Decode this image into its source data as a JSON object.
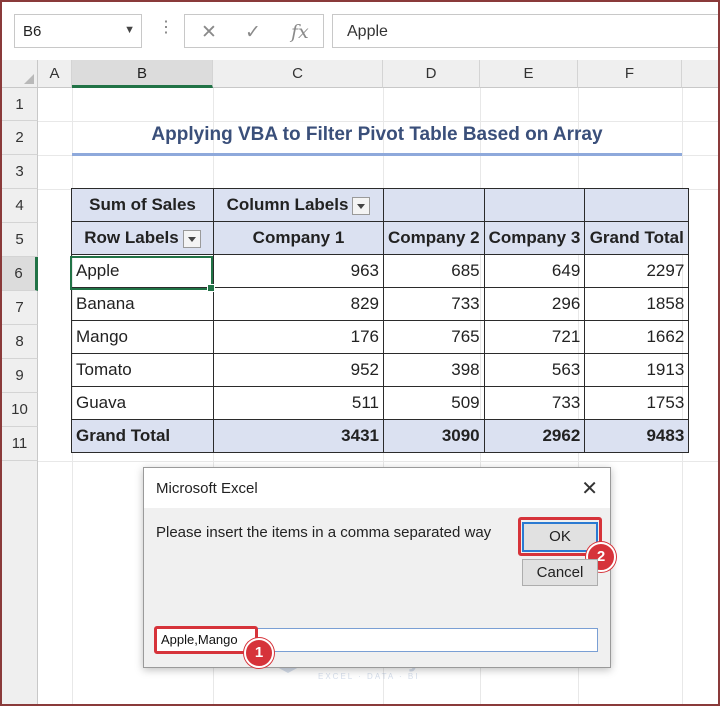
{
  "formula_bar": {
    "name_box": "B6",
    "cancel_icon": "✕",
    "enter_icon": "✓",
    "fx_icon": "fx",
    "value": "Apple"
  },
  "columns": [
    "A",
    "B",
    "C",
    "D",
    "E",
    "F"
  ],
  "rows": [
    "1",
    "2",
    "3",
    "4",
    "5",
    "6",
    "7",
    "8",
    "9",
    "10",
    "11"
  ],
  "selected_cell": "B6",
  "sheet_title": "Applying VBA to Filter Pivot Table Based on Array",
  "pivot": {
    "sum_label": "Sum of Sales",
    "column_labels": "Column Labels",
    "row_labels": "Row Labels",
    "companies": [
      "Company 1",
      "Company 2",
      "Company 3"
    ],
    "grand_total_header": "Grand Total",
    "rows": [
      {
        "label": "Apple",
        "c1": "963",
        "c2": "685",
        "c3": "649",
        "total": "2297"
      },
      {
        "label": "Banana",
        "c1": "829",
        "c2": "733",
        "c3": "296",
        "total": "1858"
      },
      {
        "label": "Mango",
        "c1": "176",
        "c2": "765",
        "c3": "721",
        "total": "1662"
      },
      {
        "label": "Tomato",
        "c1": "952",
        "c2": "398",
        "c3": "563",
        "total": "1913"
      },
      {
        "label": "Guava",
        "c1": "511",
        "c2": "509",
        "c3": "733",
        "total": "1753"
      }
    ],
    "grand_total": {
      "label": "Grand Total",
      "c1": "3431",
      "c2": "3090",
      "c3": "2962",
      "total": "9483"
    }
  },
  "dialog": {
    "title": "Microsoft Excel",
    "close_icon": "✕",
    "message": "Please insert the items in a comma separated way",
    "ok": "OK",
    "cancel": "Cancel",
    "input_value": "Apple,Mango"
  },
  "callouts": [
    "1",
    "2"
  ],
  "watermark": {
    "name": "exceldemy",
    "tagline": "EXCEL · DATA · BI"
  },
  "colors": {
    "highlight": "#d6333a",
    "excel_green": "#217346",
    "pivot_header": "#dbe1f1"
  }
}
